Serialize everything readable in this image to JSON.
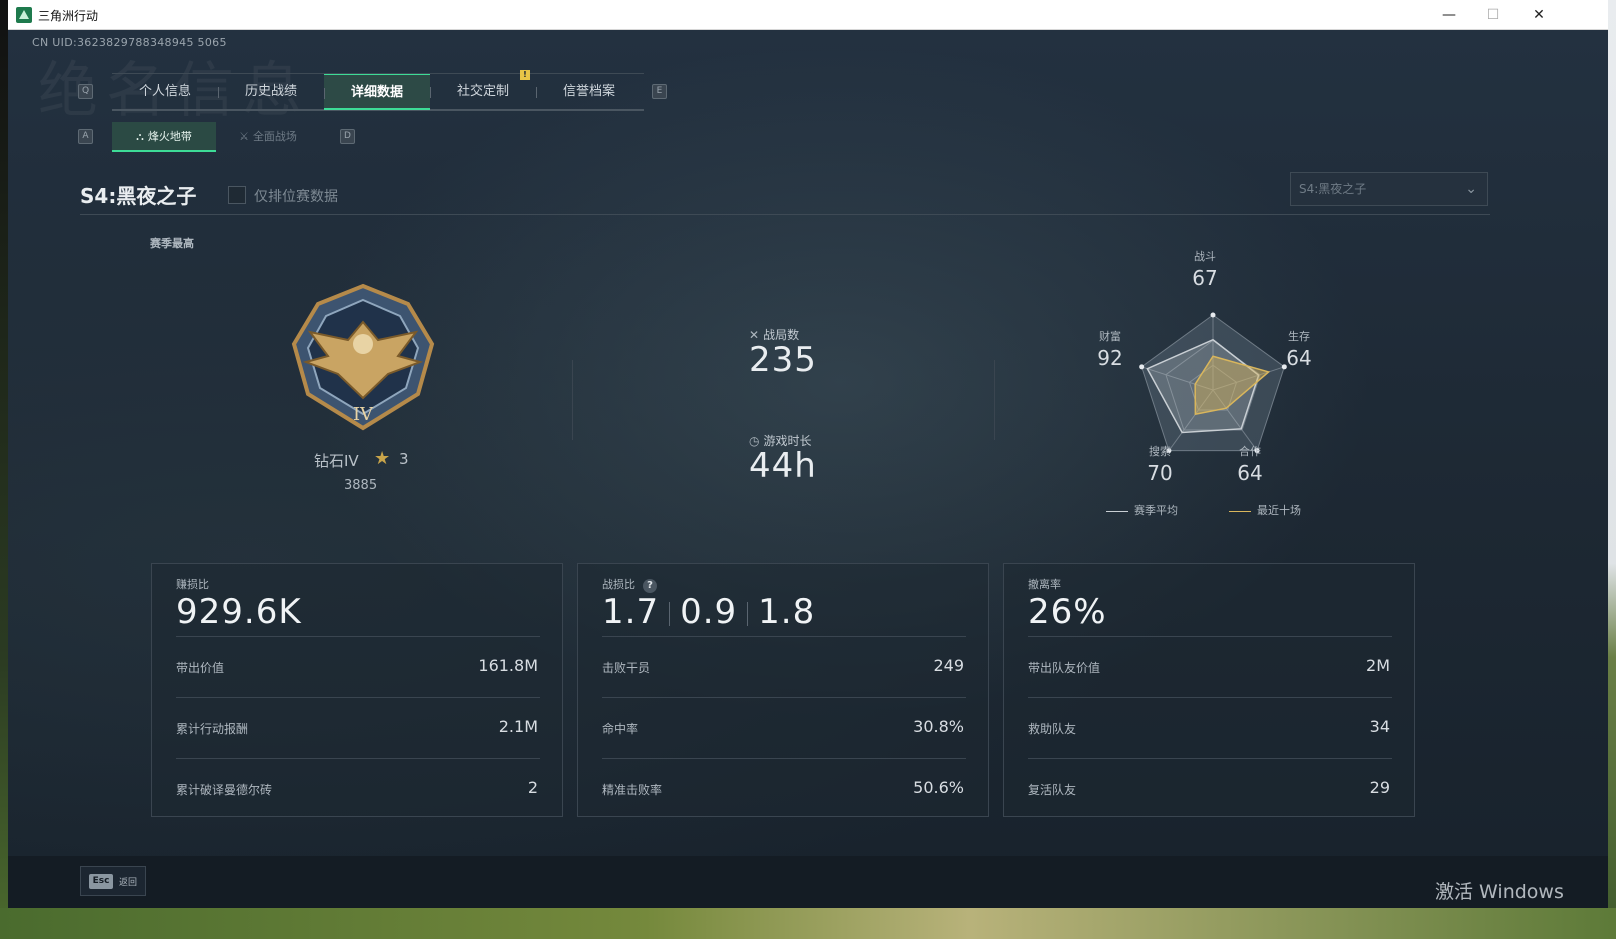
{
  "window": {
    "title": "三角洲行动",
    "controls": {
      "minimize": "—",
      "maximize": "☐",
      "close": "✕"
    }
  },
  "uid": "CN UID:3623829788348945 5065",
  "background_text": "绝名信息",
  "tabs": {
    "prev_key": "Q",
    "next_key": "E",
    "items": [
      {
        "label": "个人信息",
        "active": false
      },
      {
        "label": "历史战绩",
        "active": false
      },
      {
        "label": "详细数据",
        "active": true
      },
      {
        "label": "社交定制",
        "active": false
      },
      {
        "label": "信誉档案",
        "active": false
      }
    ],
    "badge": "!"
  },
  "subtabs": {
    "prev_key": "A",
    "next_key": "D",
    "items": [
      {
        "label": "烽火地带",
        "active": true
      },
      {
        "label": "全面战场",
        "active": false
      }
    ]
  },
  "season": {
    "title": "S4:黑夜之子",
    "ranked_only_label": "仅排位赛数据",
    "select_value": "S4:黑夜之子"
  },
  "rank": {
    "section_label": "赛季最高",
    "name": "钻石IV",
    "stars": "3",
    "score": "3885",
    "medal_numeral": "IV"
  },
  "summary": {
    "matches_label": "战局数",
    "matches_value": "235",
    "playtime_label": "游戏时长",
    "playtime_value": "44h"
  },
  "radar": {
    "axes": [
      {
        "label": "战斗",
        "value": "67"
      },
      {
        "label": "生存",
        "value": "64"
      },
      {
        "label": "合作",
        "value": "64"
      },
      {
        "label": "搜索",
        "value": "70"
      },
      {
        "label": "财富",
        "value": "92"
      }
    ],
    "season_avg": [
      67,
      64,
      64,
      70,
      92
    ],
    "recent_ten": [
      45,
      78,
      30,
      40,
      25
    ],
    "legend": {
      "season_avg": "赛季平均",
      "recent_ten": "最近十场"
    },
    "colors": {
      "season_avg": "#c9cfd4",
      "recent_ten": "#d9b65c"
    }
  },
  "cards": [
    {
      "label": "赚损比",
      "big": "929.6K",
      "rows": [
        {
          "label": "带出价值",
          "value": "161.8M"
        },
        {
          "label": "累计行动报酬",
          "value": "2.1M"
        },
        {
          "label": "累计破译曼德尔砖",
          "value": "2"
        }
      ]
    },
    {
      "label": "战损比",
      "big_parts": [
        "1.7",
        "0.9",
        "1.8"
      ],
      "help": "?",
      "rows": [
        {
          "label": "击败干员",
          "value": "249"
        },
        {
          "label": "命中率",
          "value": "30.8%"
        },
        {
          "label": "精准击败率",
          "value": "50.6%"
        }
      ]
    },
    {
      "label": "撤离率",
      "big": "26%",
      "rows": [
        {
          "label": "带出队友价值",
          "value": "2M"
        },
        {
          "label": "救助队友",
          "value": "34"
        },
        {
          "label": "复活队友",
          "value": "29"
        }
      ]
    }
  ],
  "footer": {
    "esc_key": "Esc",
    "back_label": "返回"
  },
  "watermark": "激活 Windows",
  "colors": {
    "accent": "#3ddc97",
    "gold": "#d9b65c",
    "bg": "#1c2631"
  }
}
